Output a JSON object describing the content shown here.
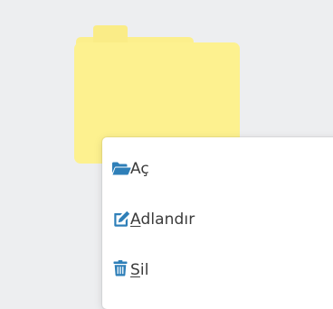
{
  "colors": {
    "desktop_background": "#edeef0",
    "folder_body": "#fdf18f",
    "folder_tab": "#faec87",
    "menu_background": "#ffffff",
    "icon_blue": "#2e7fb8",
    "menu_text": "#3b3b3b"
  },
  "desktop": {
    "folder": {
      "icon": "folder-icon"
    }
  },
  "context_menu": {
    "items": [
      {
        "icon": "folder-open-icon",
        "label_mnemonic": "",
        "label_rest": "Aç"
      },
      {
        "icon": "edit-icon",
        "label_mnemonic": "A",
        "label_rest": "dlandır"
      },
      {
        "icon": "trash-icon",
        "label_mnemonic": "S",
        "label_rest": "il"
      }
    ]
  }
}
